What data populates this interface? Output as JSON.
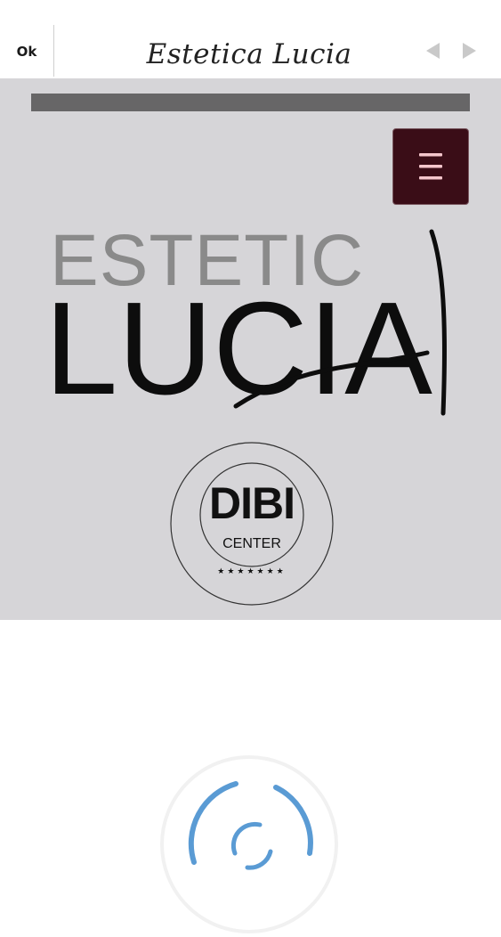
{
  "topbar": {
    "ok_label": "Ok",
    "title": "Estetica Lucia",
    "back_icon": "chevron-left-icon",
    "forward_icon": "chevron-right-icon"
  },
  "page": {
    "menu_icon": "hamburger-icon",
    "logo": {
      "line1": "ESTETIC",
      "line2": "LUCIA"
    },
    "badge": {
      "main": "DIBI",
      "sub": "CENTER",
      "stars": "★★★★★★★"
    }
  },
  "colors": {
    "content_background": "#d6d5d8",
    "progress_bar": "#676667",
    "menu_button": "#3a0d17",
    "menu_icon": "#f5c6cc",
    "spinner": "#5a9bd4"
  },
  "status": {
    "loading": true,
    "spinner_icon": "loading-spinner-icon"
  }
}
